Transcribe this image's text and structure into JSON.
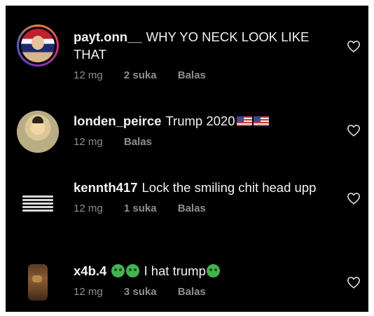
{
  "comments": [
    {
      "username": "payt.onn__",
      "text": "WHY YO NECK LOOK LIKE THAT",
      "time": "12 mg",
      "likes": "2 suka",
      "reply": "Balas",
      "avatar_icon": "profile-photo-icon"
    },
    {
      "username": "londen_peirce",
      "text": "Trump 2020",
      "emojis": [
        "us-flag-icon",
        "us-flag-icon"
      ],
      "time": "12 mg",
      "reply": "Balas",
      "avatar_icon": "profile-photo-icon"
    },
    {
      "username": "kennth417",
      "text": "Lock the smiling chit head upp",
      "time": "12 mg",
      "likes": "1 suka",
      "reply": "Balas",
      "avatar_icon": "text-image-avatar-icon"
    },
    {
      "username": "x4b.4",
      "text_after_emojis": "I hat trump",
      "emojis": [
        "nauseated-face-icon",
        "nauseated-face-icon",
        "nauseated-face-icon"
      ],
      "time": "12 mg",
      "likes": "3 suka",
      "reply": "Balas",
      "avatar_icon": "profile-photo-icon"
    }
  ],
  "colors": {
    "background": "#000000",
    "text": "#f2f2f2",
    "meta": "#8e8e8e",
    "emoji": "#44b34f"
  },
  "like_icon": "heart-outline-icon"
}
